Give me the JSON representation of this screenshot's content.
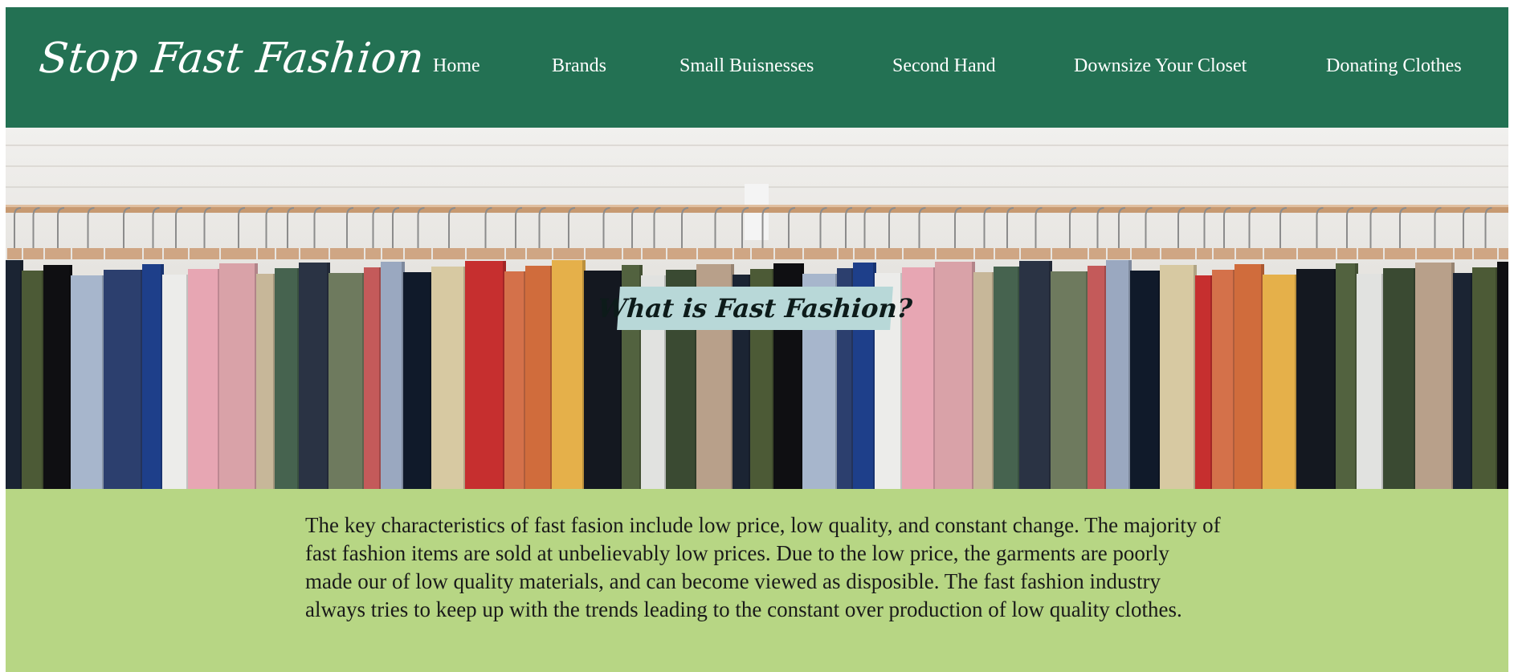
{
  "header": {
    "logo": "Stop Fast Fashion",
    "nav": [
      {
        "label": "Home"
      },
      {
        "label": "Brands"
      },
      {
        "label": "Small Buisnesses"
      },
      {
        "label": "Second Hand"
      },
      {
        "label": "Downsize Your Closet"
      },
      {
        "label": "Donating Clothes"
      }
    ]
  },
  "hero": {
    "caption": "What is Fast Fashion?"
  },
  "content": {
    "paragraph": "The key characteristics of fast fasion include low price, low quality, and constant change. The majority of fast fashion items are sold at unbelievably low prices. Due to the low price, the garments are poorly made our of low quality materials, and can become viewed as disposible. The fast fashion industry always tries to keep up with the trends leading to the constant over production of low quality clothes."
  },
  "colors": {
    "header_bg": "#237153",
    "content_bg": "#b7d684",
    "caption_bg": "#b8d8d8"
  }
}
